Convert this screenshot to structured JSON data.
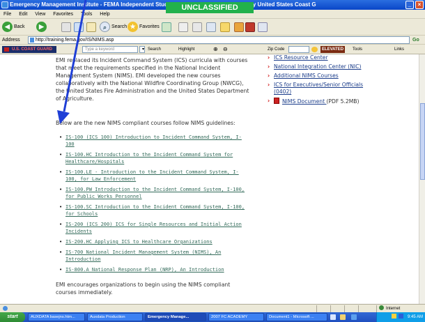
{
  "window": {
    "title": "Emergency Management Institute - FEMA Independent Study Pro",
    "title_suffix": "by United States Coast G",
    "classification_banner": "UNCLASSIFIED"
  },
  "menu": [
    "File",
    "Edit",
    "View",
    "Favorites",
    "Tools",
    "Help"
  ],
  "toolbar": {
    "back_label": "Back",
    "search_label": "Search",
    "favorites_label": "Favorites"
  },
  "address": {
    "label": "Address",
    "url": "http://training.fema.gov/IS/NIMS.asp",
    "go_label": "Go"
  },
  "google_bar": {
    "search_placeholder": "Type a keyword",
    "search_label": "Search",
    "highlight_label": "Highlight",
    "zip_label": "Zip Code",
    "elevated_label": "ELEVATED",
    "tools_label": "Tools",
    "links_label": "Links"
  },
  "content": {
    "intro": [
      "EMI replaced its Incident Command System (ICS) curricula with courses",
      "that meet the requirements specified in the National Incident",
      "Management System (NIMS). EMI developed the new courses",
      "collaboratively with the National Wildfire Coordinating Group (NWCG),",
      "the United States Fire Administration and the United States Department",
      "of Agriculture."
    ],
    "list_heading": "Below are the new NIMS compliant courses follow NIMS guidelines:",
    "courses": [
      [
        "IS-100 (ICS 100) Introduction to Incident Command System, I-",
        "100"
      ],
      [
        "IS-100.HC Introduction to the Incident Command System for",
        "Healthcare/Hospitals"
      ],
      [
        "IS-100.LE - Introduction to the Incident Command System, I-",
        "100, for Law Enforcement"
      ],
      [
        "IS-100.PW Introduction to the Incident Command System, I-100,",
        "for Public Works Personnel"
      ],
      [
        "IS-100.SC Introduction to the Incident Command System, I-100,",
        "for Schools"
      ],
      [
        "IS-200 (ICS 200) ICS for Single Resources and Initial Action",
        "Incidents"
      ],
      [
        "IS-200.HC Applying ICS to Healthcare Organizations"
      ],
      [
        "IS-700 National Incident Management System (NIMS), An",
        "Introduction"
      ],
      [
        "IS-800.A National Response Plan (NRP), An Introduction"
      ]
    ],
    "closing": [
      "EMI encourages organizations to begin using the NIMS compliant",
      "courses immediately."
    ],
    "sidebar_links": [
      [
        "ICS Resource Center"
      ],
      [
        "National Integration Center (NIC)"
      ],
      [
        "Additional NIMS Courses"
      ],
      [
        "ICS for Executives/Senior Officials",
        "(0402)"
      ]
    ],
    "pdf_link": "NIMS Document",
    "pdf_suffix": "(PDF 5.2MB)"
  },
  "status": {
    "zone": "Internet"
  },
  "taskbar": {
    "start": "start",
    "tasks": [
      "AUXDATA basejns.htm...",
      "Auxdata Production",
      "Emergency Manage...",
      "2007 FC ACADEMY",
      "Document1 - Microsoft ..."
    ],
    "clock": "9:45 AM"
  },
  "colors": {
    "link_green": "#336b5a",
    "link_blue": "#1a3c8a",
    "banner_green": "#22b14c",
    "arrow_blue": "#1f3fd6"
  }
}
